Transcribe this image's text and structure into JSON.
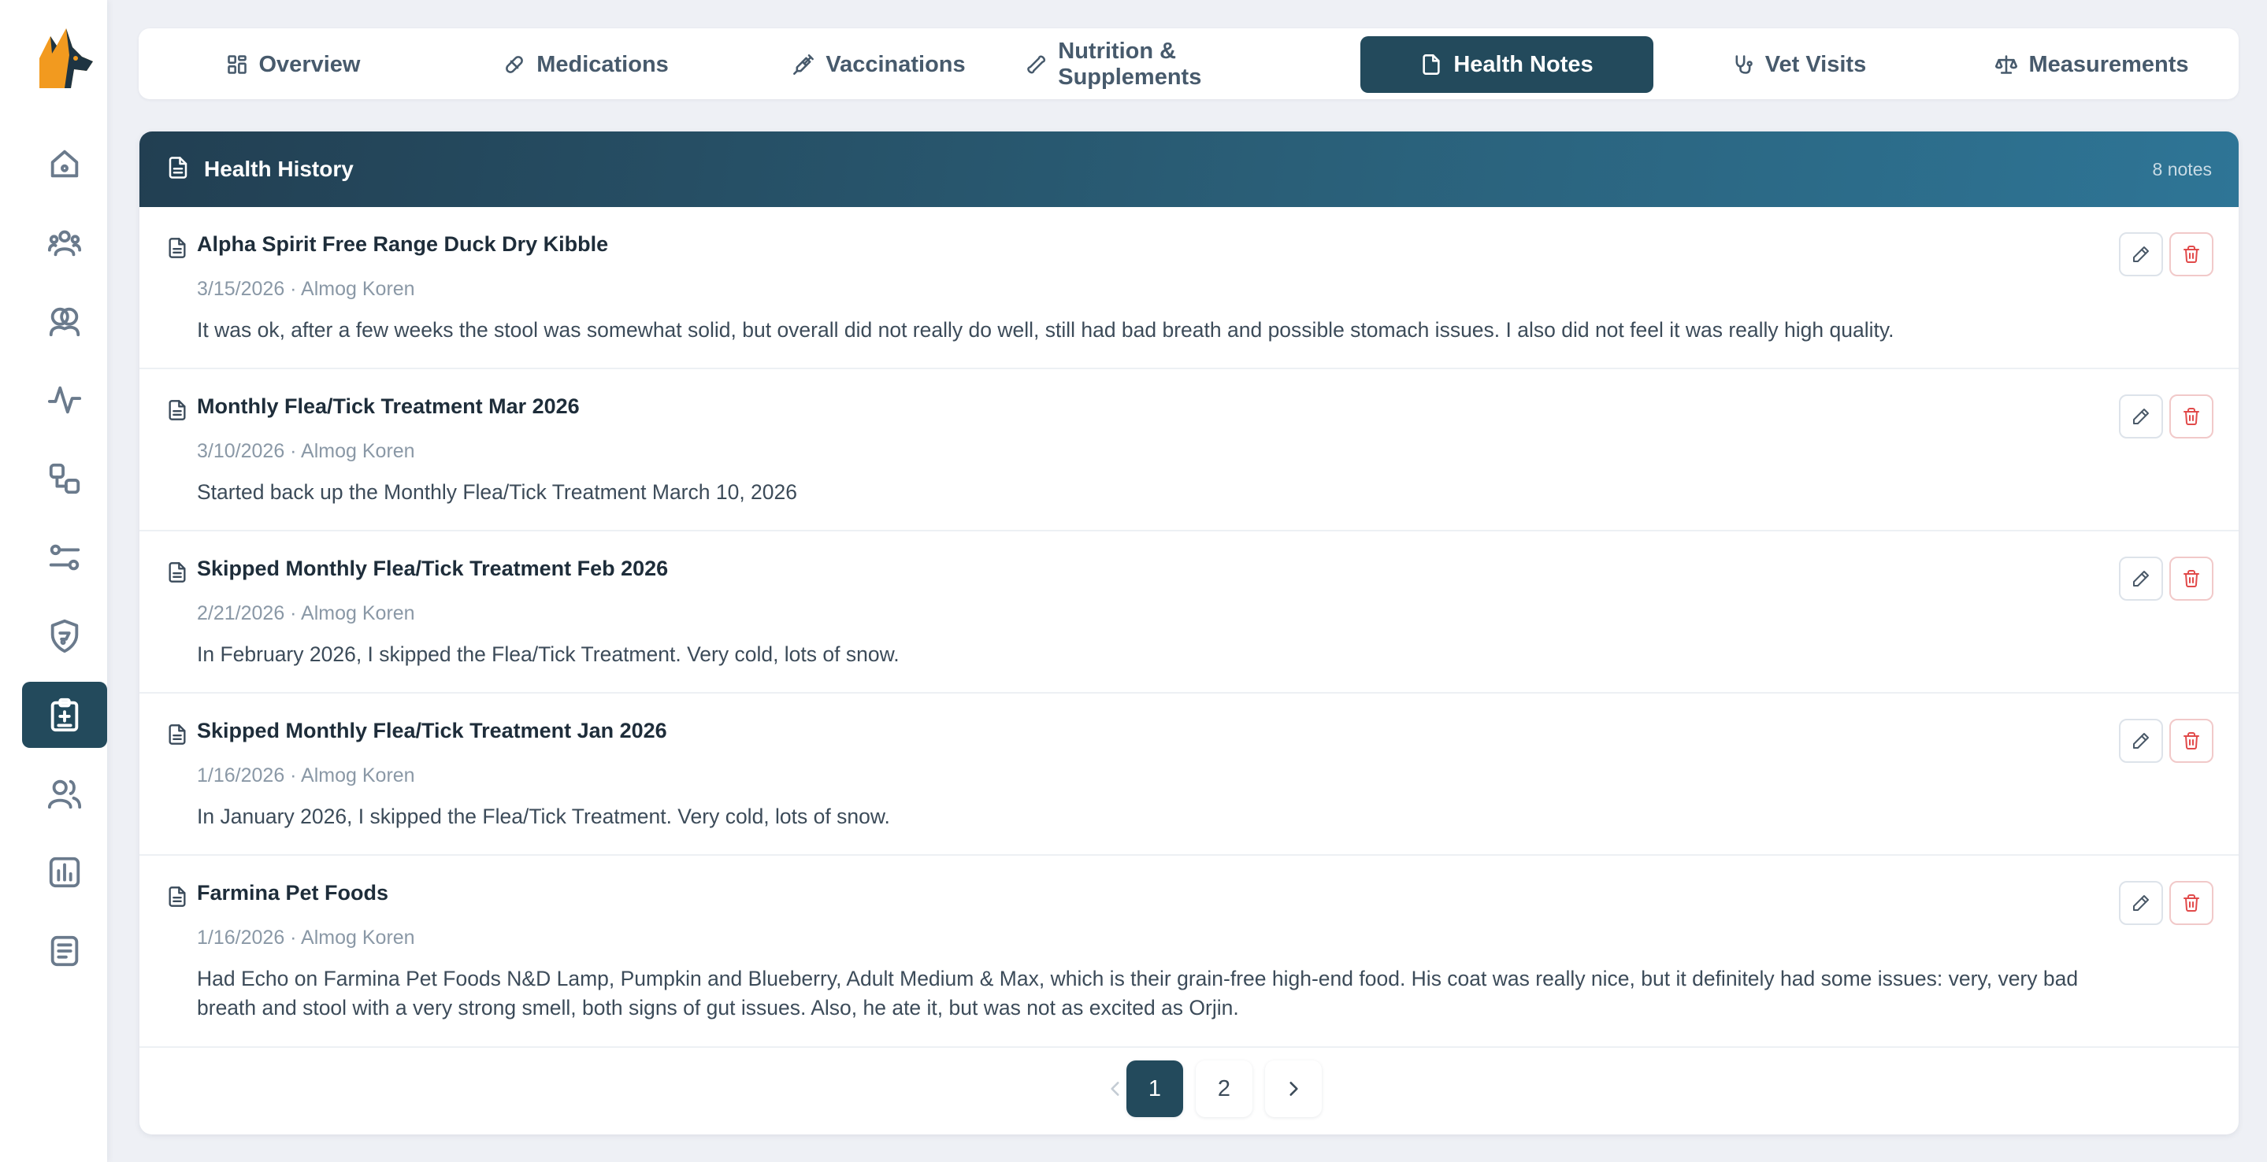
{
  "tabs": [
    {
      "label": "Overview",
      "icon": "grid-icon"
    },
    {
      "label": "Medications",
      "icon": "pill-icon"
    },
    {
      "label": "Vaccinations",
      "icon": "syringe-icon"
    },
    {
      "label": "Nutrition & Supplements",
      "icon": "bone-icon"
    },
    {
      "label": "Health Notes",
      "icon": "file-icon",
      "active": true
    },
    {
      "label": "Vet Visits",
      "icon": "stethoscope-icon"
    },
    {
      "label": "Measurements",
      "icon": "scale-icon"
    }
  ],
  "sidebar": {
    "logo": "dog-logo",
    "items": [
      {
        "icon": "home-icon"
      },
      {
        "icon": "pack-icon"
      },
      {
        "icon": "pets-icon"
      },
      {
        "icon": "activity-icon"
      },
      {
        "icon": "workflow-icon"
      },
      {
        "icon": "sliders-icon"
      },
      {
        "icon": "shield-paw-icon"
      },
      {
        "icon": "medical-clipboard-icon",
        "active": true
      },
      {
        "icon": "users-icon"
      },
      {
        "icon": "chart-icon"
      },
      {
        "icon": "notes-icon"
      }
    ]
  },
  "card": {
    "title": "Health History",
    "count": "8 notes"
  },
  "notes": [
    {
      "title": "Alpha Spirit Free Range Duck Dry Kibble",
      "meta": "3/15/2026 · Almog Koren",
      "body": "It was ok, after a few weeks the stool was somewhat solid, but overall did not really do well, still had bad breath and possible stomach issues. I also did not feel it was really high quality."
    },
    {
      "title": "Monthly Flea/Tick Treatment Mar 2026",
      "meta": "3/10/2026 · Almog Koren",
      "body": "Started back up the Monthly Flea/Tick Treatment March 10, 2026"
    },
    {
      "title": "Skipped Monthly Flea/Tick Treatment Feb 2026",
      "meta": "2/21/2026 · Almog Koren",
      "body": "In February 2026, I skipped the Flea/Tick Treatment. Very cold, lots of snow."
    },
    {
      "title": "Skipped Monthly Flea/Tick Treatment Jan 2026",
      "meta": "1/16/2026 · Almog Koren",
      "body": "In January 2026, I skipped the Flea/Tick Treatment. Very cold, lots of snow."
    },
    {
      "title": "Farmina Pet Foods",
      "meta": "1/16/2026 · Almog Koren",
      "body": "Had Echo on Farmina Pet Foods N&D Lamp, Pumpkin and Blueberry, Adult Medium & Max, which is their grain-free high-end food. His coat was really nice, but it definitely had some issues: very, very bad breath and stool with a very strong smell, both signs of gut issues. Also, he ate it, but was not as excited as Orjin."
    }
  ],
  "pagination": {
    "pages": [
      "1",
      "2"
    ],
    "current": "1"
  },
  "colors": {
    "primary": "#234a5c",
    "danger": "#e14a4a",
    "accent_logo": "#f29a1f"
  }
}
